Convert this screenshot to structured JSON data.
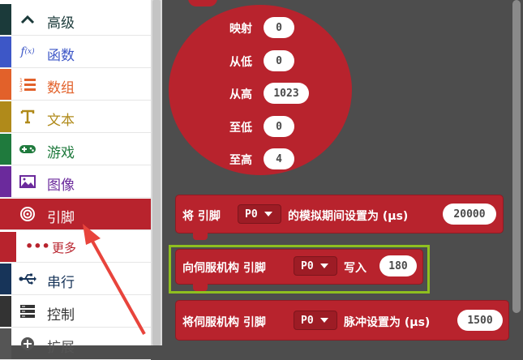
{
  "sidebar": {
    "items": [
      {
        "label": "高级",
        "color": "#1b3a3a",
        "icon": "chevron-up-icon"
      },
      {
        "label": "函数",
        "color": "#3d57c7",
        "icon": "function-icon"
      },
      {
        "label": "数组",
        "color": "#e2612a",
        "icon": "list-numbered-icon"
      },
      {
        "label": "文本",
        "color": "#b08a1a",
        "icon": "text-icon"
      },
      {
        "label": "游戏",
        "color": "#1f7a3d",
        "icon": "gamepad-icon"
      },
      {
        "label": "图像",
        "color": "#6b2a9c",
        "icon": "image-icon"
      },
      {
        "label": "引脚",
        "color": "#b8232d",
        "icon": "pin-target-icon"
      },
      {
        "label": "串行",
        "color": "#173459",
        "icon": "usb-icon"
      },
      {
        "label": "控制",
        "color": "#333333",
        "icon": "server-icon"
      },
      {
        "label": "扩展",
        "color": "#555555",
        "icon": "plus-circle-icon"
      }
    ],
    "sub_item": {
      "label": "更多",
      "icon": "more-dots-icon",
      "dots": "•••"
    }
  },
  "map_block": {
    "rows": [
      {
        "label": "映射",
        "value": "0"
      },
      {
        "label": "从低",
        "value": "0"
      },
      {
        "label": "从高",
        "value": "1023"
      },
      {
        "label": "至低",
        "value": "0"
      },
      {
        "label": "至高",
        "value": "4"
      }
    ]
  },
  "blocks": {
    "analog_period": {
      "prefix": "将 引脚",
      "pin": "P0",
      "middle": "的模拟期间设置为 (µs)",
      "value": "20000"
    },
    "servo_write": {
      "prefix": "向伺服机构 引脚",
      "pin": "P0",
      "middle": "写入",
      "value": "180"
    },
    "servo_pulse": {
      "prefix": "将伺服机构 引脚",
      "pin": "P0",
      "middle": "脉冲设置为 (µs)",
      "value": "1500"
    }
  },
  "colors": {
    "pins": "#b8232d",
    "highlight": "#8fbf1f",
    "arrow": "#e8443c"
  }
}
